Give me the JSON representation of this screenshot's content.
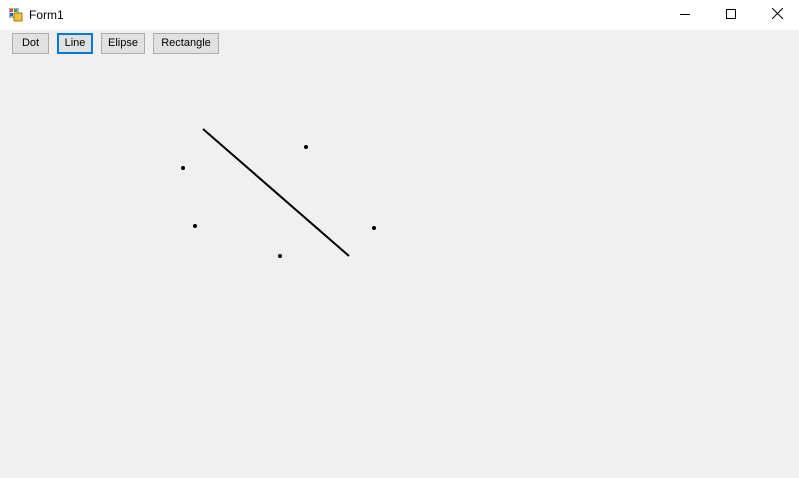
{
  "window": {
    "title": "Form1",
    "icon": "winforms-app-icon",
    "controls": {
      "minimize_icon": "minimize-icon",
      "maximize_icon": "maximize-icon",
      "close_icon": "close-icon"
    }
  },
  "toolbar": {
    "dot_label": "Dot",
    "line_label": "Line",
    "elipse_label": "Elipse",
    "rectangle_label": "Rectangle",
    "selected_tool": "Line"
  },
  "colors": {
    "window_bg": "#f0f0f0",
    "titlebar_bg": "#ffffff",
    "button_bg": "#e1e1e1",
    "button_border": "#adadad",
    "focus_border": "#0078d7",
    "drawing": "#000000"
  }
}
